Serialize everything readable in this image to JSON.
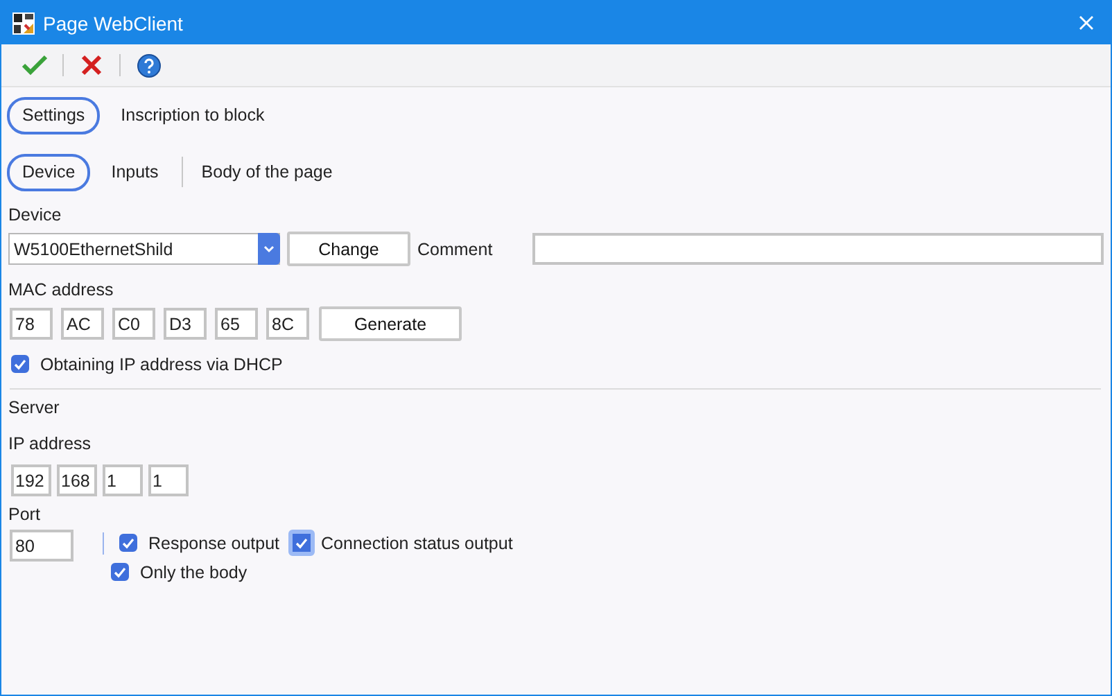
{
  "window": {
    "title": "Page WebClient"
  },
  "toolbar": [
    {
      "kind": "ok"
    },
    {
      "kind": "cancel"
    },
    {
      "kind": "help"
    }
  ],
  "main_tabs": [
    {
      "label": "Settings",
      "selected": true
    },
    {
      "label": "Inscription to block",
      "selected": false
    }
  ],
  "sub_tabs": [
    {
      "label": "Device",
      "selected": true
    },
    {
      "label": "Inputs",
      "selected": false
    },
    {
      "label": "Body of the page",
      "selected": false
    }
  ],
  "device": {
    "label": "Device",
    "value": "W5100EthernetShild",
    "change_button": "Change",
    "comment_label": "Comment"
  },
  "mac": {
    "label": "MAC address",
    "octets": [
      "78",
      "AC",
      "C0",
      "D3",
      "65",
      "8C"
    ],
    "generate_button": "Generate"
  },
  "dhcp": {
    "label": "Obtaining IP address via DHCP",
    "checked": true
  },
  "server": {
    "title": "Server",
    "ip_label": "IP address",
    "ip": [
      "192",
      "168",
      "1",
      "1"
    ],
    "port_label": "Port",
    "port": "80"
  },
  "options": [
    {
      "label": "Response output",
      "checked": true,
      "focused": false
    },
    {
      "label": "Connection status output",
      "checked": true,
      "focused": true
    },
    {
      "label": "Only the body",
      "checked": true,
      "focused": false
    }
  ]
}
